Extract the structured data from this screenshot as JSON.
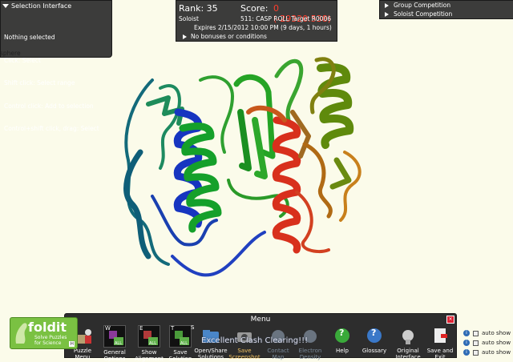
{
  "selection": {
    "header": "Selection Interface",
    "lines": [
      "Nothing selected",
      "Click: Select",
      "Shift click: Select range",
      "Control click: Add to selection",
      "Control+shift click, drag: Select"
    ],
    "sphere": "sphere"
  },
  "score_panel": {
    "rank": "Rank: 35",
    "score_label": "Score:",
    "score_value": "0 (-29320.538)",
    "mode": "Soloist",
    "puzzle": "511: CASP ROLL Target R0006",
    "expires": "Expires 2/15/2012 10:00 PM (9 days, 1 hours)",
    "bonus": "No bonuses or conditions"
  },
  "competition": {
    "group": "Group Competition",
    "soloist": "Soloist Competition"
  },
  "menu": {
    "title": "Menu",
    "items": [
      {
        "label": "Puzzle\nMenu",
        "icon": "puzzle-person-icon"
      },
      {
        "label": "General\nOptions",
        "icon": "general-options-icon",
        "key": "W"
      },
      {
        "label": "Show\nAlignment",
        "icon": "show-alignment-icon",
        "key": "E"
      },
      {
        "label": "Save\nSolution",
        "icon": "save-solution-icon",
        "key": "T"
      },
      {
        "label": "Open/Share\nSolutions",
        "icon": "folder-icon",
        "key": "S"
      },
      {
        "label": "Save\nScreenshot",
        "icon": "camera-icon"
      },
      {
        "label": "Contact\nMap",
        "icon": "contact-map-icon"
      },
      {
        "label": "Electron\nDensity",
        "icon": "electron-density-icon"
      },
      {
        "label": "Help",
        "icon": "help-icon"
      },
      {
        "label": "Glossary",
        "icon": "glossary-icon"
      },
      {
        "label": "Original\nInterface",
        "icon": "original-interface-icon"
      },
      {
        "label": "Save and\nExit",
        "icon": "exit-icon"
      }
    ],
    "all_badge": "ALL",
    "clash_message": "Excellent Clash Clearing!!!"
  },
  "logo": {
    "brand": "foldit",
    "tagline": "Solve Puzzles\nfor Science",
    "hotkey": "H"
  },
  "auto_show": [
    "auto show",
    "auto show",
    "auto show"
  ],
  "colors": {
    "panel": "#303030",
    "score_red": "#ff3c2c",
    "background": "#fbfbea",
    "logo_green": "#7ac142"
  }
}
